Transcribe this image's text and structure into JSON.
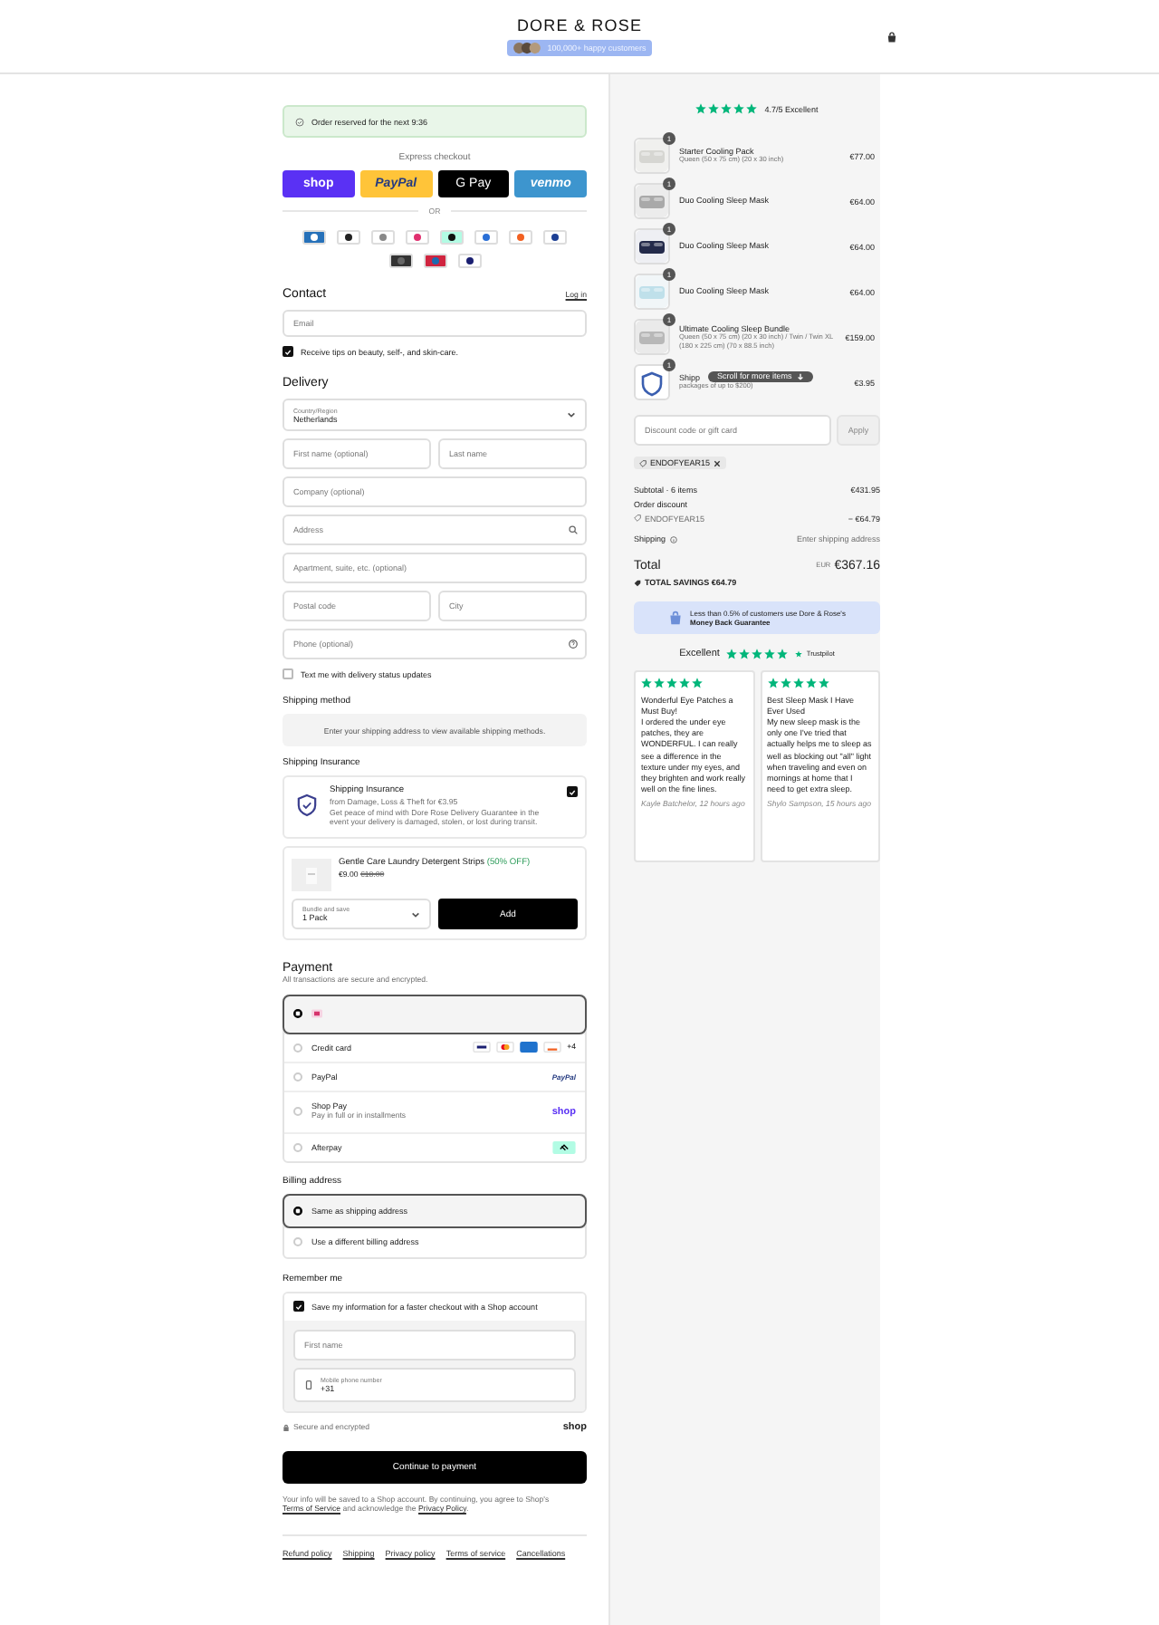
{
  "header": {
    "brand": "DORE & ROSE",
    "badge": "100,000+ happy customers"
  },
  "reservation": "Order reserved for the next 9:36",
  "express": {
    "label": "Express checkout",
    "divider": "OR",
    "buttons": [
      {
        "kind": "shop",
        "label": "shop"
      },
      {
        "kind": "paypal",
        "label": "PayPal"
      },
      {
        "kind": "gpay",
        "label": "G Pay"
      },
      {
        "kind": "venmo",
        "label": "venmo"
      }
    ]
  },
  "contact": {
    "title": "Contact",
    "login": "Log in",
    "email_placeholder": "Email",
    "marketing": {
      "label": "Receive tips on beauty, self-, and skin-care.",
      "checked": true
    }
  },
  "delivery": {
    "title": "Delivery",
    "country": {
      "label": "Country/Region",
      "value": "Netherlands"
    },
    "rows": [
      [
        {
          "placeholder": "First name (optional)"
        },
        {
          "placeholder": "Last name"
        }
      ],
      [
        {
          "placeholder": "Company (optional)"
        }
      ],
      [
        {
          "placeholder": "Address",
          "kind": "search"
        }
      ],
      [
        {
          "placeholder": "Apartment, suite, etc. (optional)"
        }
      ],
      [
        {
          "placeholder": "Postal code"
        },
        {
          "placeholder": "City"
        }
      ],
      [
        {
          "placeholder": "Phone (optional)",
          "kind": "help"
        }
      ]
    ],
    "sms": {
      "label": "Text me with delivery status updates",
      "checked": false
    }
  },
  "shipping_method": {
    "title": "Shipping method",
    "message": "Enter your shipping address to view available shipping methods."
  },
  "insurance": {
    "title": "Shipping Insurance",
    "name": "Shipping Insurance",
    "subtitle": "from Damage, Loss & Theft for €3.95",
    "description": "Get peace of mind with Dore Rose Delivery Guarantee in the event your delivery is damaged, stolen, or lost during transit.",
    "checked": true
  },
  "upsell": {
    "name": "Gentle Care Laundry Detergent Strips",
    "discount": "(50% OFF)",
    "price": "€9.00",
    "old_price": "€18.00",
    "select_label": "Bundle and save",
    "select_value": "1 Pack",
    "button": "Add"
  },
  "payment": {
    "title": "Payment",
    "subtitle": "All transactions are secure and encrypted.",
    "options": [
      {
        "kind": "wallet",
        "selected": true
      },
      {
        "label": "Credit card",
        "kind": "cards",
        "more": "+4",
        "selected": false
      },
      {
        "label": "PayPal",
        "kind": "paypal",
        "logo_text": "PayPal",
        "selected": false
      },
      {
        "label": "Shop Pay",
        "sub": "Pay in full or in installments",
        "kind": "shop",
        "logo_text": "shop",
        "selected": false
      },
      {
        "label": "Afterpay",
        "kind": "afterpay",
        "selected": false
      }
    ]
  },
  "billing": {
    "title": "Billing address",
    "options": [
      {
        "label": "Same as shipping address",
        "selected": true
      },
      {
        "label": "Use a different billing address",
        "selected": false
      }
    ]
  },
  "remember": {
    "title": "Remember me",
    "save": {
      "label": "Save my information for a faster checkout with a Shop account",
      "checked": true
    },
    "first_name_placeholder": "First name",
    "phone": {
      "label": "Mobile phone number",
      "value": "+31"
    },
    "secure": "Secure and encrypted",
    "brand": "shop"
  },
  "continue": "Continue to payment",
  "legal": {
    "before": "Your info will be saved to a Shop account. By continuing, you agree to Shop's",
    "link1": "Terms of Service",
    "middle": "and acknowledge the",
    "link2": "Privacy Policy",
    "after": "."
  },
  "footer_links": [
    "Refund policy",
    "Shipping",
    "Privacy policy",
    "Terms of service",
    "Cancellations"
  ],
  "rating": {
    "stars": 5,
    "text": "4.7/5 Excellent"
  },
  "items": [
    {
      "kind": "picture",
      "quantity": "1",
      "name": "Starter Cooling Pack",
      "variant": "Queen (50 x 75 cm) (20 x 30 inch)",
      "price": "€77.00"
    },
    {
      "kind": "picture",
      "quantity": "1",
      "name": "Duo Cooling Sleep Mask",
      "price": "€64.00"
    },
    {
      "kind": "picture",
      "quantity": "1",
      "name": "Duo Cooling Sleep Mask",
      "price": "€64.00"
    },
    {
      "kind": "picture",
      "quantity": "1",
      "name": "Duo Cooling Sleep Mask",
      "price": "€64.00"
    },
    {
      "kind": "picture",
      "quantity": "1",
      "name": "Ultimate Cooling Sleep Bundle",
      "variant": "Queen (50 x 75 cm) (20 x 30 inch) / Twin / Twin XL (180 x 225 cm) (70 x 88.5 inch)",
      "price": "€159.00"
    },
    {
      "kind": "shield",
      "quantity": "1",
      "name": "Shipp",
      "variant": "packages of up to $200)",
      "price": "€3.95"
    }
  ],
  "scroll_hint": "Scroll for more items",
  "discount": {
    "placeholder": "Discount code or gift card",
    "button": "Apply",
    "code": "ENDOFYEAR15"
  },
  "summary": {
    "subtotal_label": "Subtotal · 6 items",
    "subtotal": "€431.95",
    "discount_label": "Order discount",
    "discount_code": "ENDOFYEAR15",
    "discount_value": "− €64.79",
    "shipping_label": "Shipping",
    "shipping_value": "Enter shipping address",
    "total_label": "Total",
    "currency": "EUR",
    "total": "€367.16",
    "savings": "TOTAL SAVINGS €64.79"
  },
  "guarantee": "Less than 0.5% of customers use Dore & Rose's\n**Money Back Guarantee**",
  "trustpilot": {
    "label": "Excellent",
    "stars": 5,
    "brand": "Trustpilot"
  },
  "reviews": [
    {
      "stars": 5,
      "title": "Wonderful Eye Patches a Must Buy!",
      "body": "I ordered the under eye patches, they are WONDERFUL. I can really see a difference in the texture under my eyes, and they brighten and work really well on the fine lines.",
      "author": "Kayle Batchelor, 12 hours ago"
    },
    {
      "stars": 5,
      "title": "Best Sleep Mask I Have Ever Used",
      "body": "My new sleep mask is the only one I've tried that actually helps me to sleep as well as blocking out \"all\" light when traveling and even on mornings at home that I need to get extra sleep.",
      "author": "Shylo Sampson, 15 hours ago"
    }
  ]
}
